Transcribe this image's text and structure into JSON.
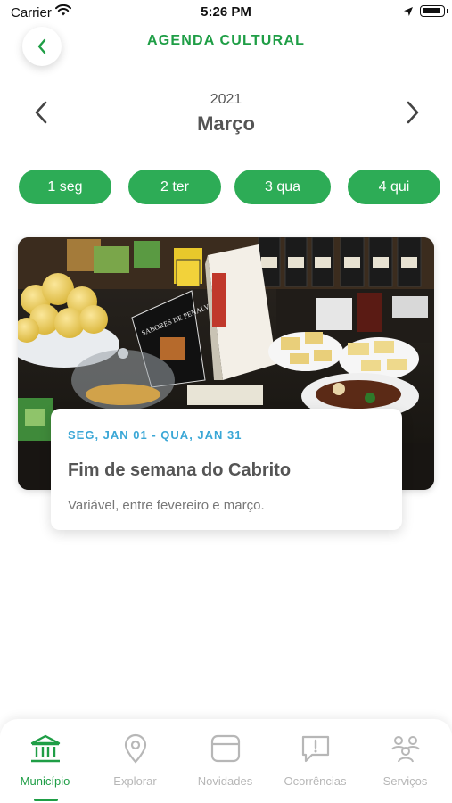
{
  "status_bar": {
    "carrier": "Carrier",
    "time": "5:26 PM"
  },
  "header": {
    "title": "AGENDA CULTURAL",
    "back_icon": "chevron-left-icon"
  },
  "month_nav": {
    "year": "2021",
    "month": "Março",
    "prev_icon": "chevron-left-icon",
    "next_icon": "chevron-right-icon"
  },
  "day_chips": [
    "1 seg",
    "2 ter",
    "3 qua",
    "4 qui"
  ],
  "event": {
    "dates": "SEG, JAN 01 - QUA, JAN 31",
    "title": "Fim de semana do Cabrito",
    "description": "Variável, entre fevereiro e março.",
    "image_sign": "SABORES DE PENALVA"
  },
  "tabs": [
    {
      "label": "Município",
      "icon": "municipality-building-icon",
      "active": true
    },
    {
      "label": "Explorar",
      "icon": "map-pin-icon",
      "active": false
    },
    {
      "label": "Novidades",
      "icon": "news-card-icon",
      "active": false
    },
    {
      "label": "Ocorrências",
      "icon": "report-alert-icon",
      "active": false
    },
    {
      "label": "Serviços",
      "icon": "services-people-icon",
      "active": false
    }
  ],
  "colors": {
    "brand_green": "#1f9e46",
    "chip_green": "#2dac56",
    "date_blue": "#3aa7d6"
  }
}
